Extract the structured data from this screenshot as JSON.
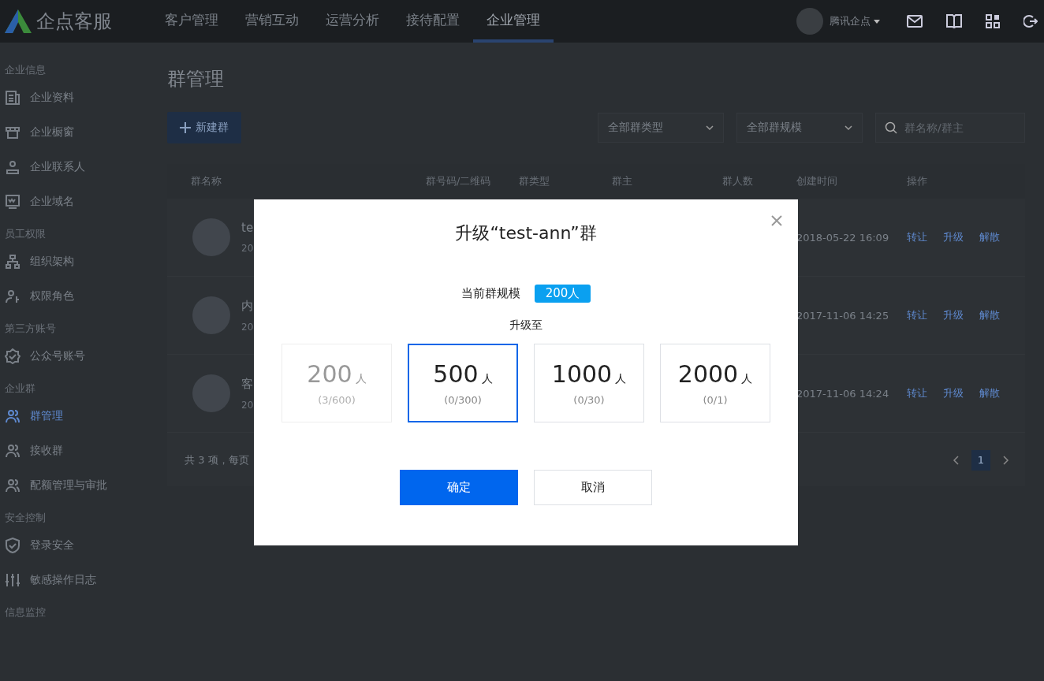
{
  "topbar": {
    "logo": "企点客服",
    "nav": [
      {
        "label": "客户管理",
        "selected": false
      },
      {
        "label": "营销互动",
        "selected": false
      },
      {
        "label": "运营分析",
        "selected": false
      },
      {
        "label": "接待配置",
        "selected": false
      },
      {
        "label": "企业管理",
        "selected": true
      }
    ],
    "account": "腾讯企点"
  },
  "sidebar": {
    "sections": [
      {
        "heading": "企业信息",
        "items": [
          {
            "label": "企业资料",
            "selected": false
          },
          {
            "label": "企业橱窗",
            "selected": false
          },
          {
            "label": "企业联系人",
            "selected": false
          },
          {
            "label": "企业域名",
            "selected": false
          }
        ]
      },
      {
        "heading": "员工权限",
        "items": [
          {
            "label": "组织架构",
            "selected": false
          },
          {
            "label": "权限角色",
            "selected": false
          }
        ]
      },
      {
        "heading": "第三方账号",
        "items": [
          {
            "label": "公众号账号",
            "selected": false
          }
        ]
      },
      {
        "heading": "企业群",
        "items": [
          {
            "label": "群管理",
            "selected": true
          },
          {
            "label": "接收群",
            "selected": false
          },
          {
            "label": "配额管理与审批",
            "selected": false
          }
        ]
      },
      {
        "heading": "安全控制",
        "items": [
          {
            "label": "登录安全",
            "selected": false
          },
          {
            "label": "敏感操作日志",
            "selected": false
          }
        ]
      },
      {
        "heading": "信息监控"
      }
    ]
  },
  "page": {
    "title": "群管理",
    "new_button": "新建群",
    "filters": [
      "全部群类型",
      "全部群规模"
    ],
    "search": {
      "placeholder": "群名称/群主"
    },
    "table": {
      "columns": [
        "群名称",
        "群号码/二维码",
        "群类型",
        "群主",
        "群人数",
        "创建时间",
        "操作"
      ],
      "rows": [
        {
          "name": "te",
          "sub": "20",
          "created": "2018-05-22 16:09",
          "actions": [
            "转让",
            "升级",
            "解散"
          ]
        },
        {
          "name": "内",
          "sub": "20",
          "created": "2017-11-06 14:25",
          "actions": [
            "转让",
            "升级",
            "解散"
          ]
        },
        {
          "name": "客",
          "sub": "20",
          "created": "2017-11-06 14:24",
          "actions": [
            "转让",
            "升级",
            "解散"
          ]
        }
      ]
    },
    "footer": "共 3 项，每页",
    "pages": [
      {
        "label": "1",
        "selected": true
      }
    ]
  },
  "dialog": {
    "title": "升级“test-ann”群",
    "current_label": "当前群规模",
    "current_value": "200人",
    "upgrade_label": "升级至",
    "options": [
      {
        "size": "200",
        "unit": "人",
        "quota": "(3/600)",
        "selected": false,
        "disabled": true
      },
      {
        "size": "500",
        "unit": "人",
        "quota": "(0/300)",
        "selected": true,
        "disabled": false
      },
      {
        "size": "1000",
        "unit": "人",
        "quota": "(0/30)",
        "selected": false,
        "disabled": false
      },
      {
        "size": "2000",
        "unit": "人",
        "quota": "(0/1)",
        "selected": false,
        "disabled": false
      }
    ],
    "confirm": "确定",
    "cancel": "取消"
  }
}
